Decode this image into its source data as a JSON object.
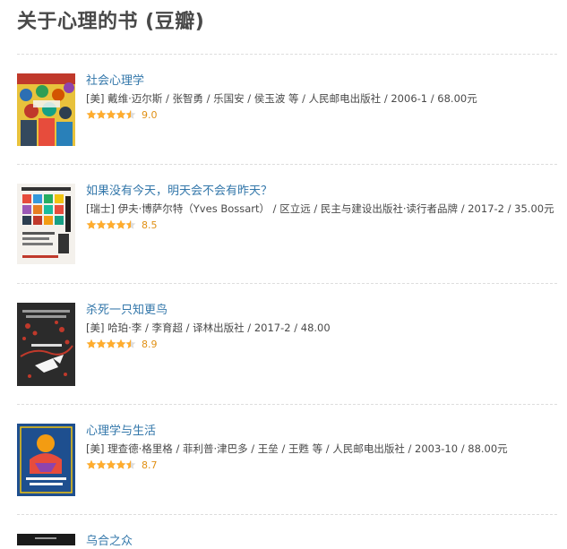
{
  "page": {
    "title": "关于心理的书 (豆瓣)"
  },
  "books": [
    {
      "title": "社会心理学",
      "meta": "[美] 戴维·迈尔斯 / 张智勇 / 乐国安 / 侯玉波 等 / 人民邮电出版社 / 2006-1 / 68.00元",
      "rating": "9.0",
      "stars": 4.5
    },
    {
      "title": "如果没有今天，明天会不会有昨天？",
      "meta": "[瑞士] 伊夫·博萨尔特（Yves Bossart） / 区立远 / 民主与建设出版社·读行者品牌 / 2017-2 / 35.00元",
      "rating": "8.5",
      "stars": 4.5
    },
    {
      "title": "杀死一只知更鸟",
      "meta": "[美] 哈珀·李 / 李育超 / 译林出版社 / 2017-2 / 48.00",
      "rating": "8.9",
      "stars": 4.5
    },
    {
      "title": "心理学与生活",
      "meta": "[美] 理查德·格里格 / 菲利普·津巴多 / 王垒 / 王甦 等 / 人民邮电出版社 / 2003-10 / 88.00元",
      "rating": "8.7",
      "stars": 4.5
    },
    {
      "title": "乌合之众",
      "meta": "",
      "rating": "",
      "stars": 0
    }
  ],
  "colors": {
    "link": "#3377aa",
    "star": "#ffac2d",
    "score": "#e09015",
    "text": "#494949"
  }
}
